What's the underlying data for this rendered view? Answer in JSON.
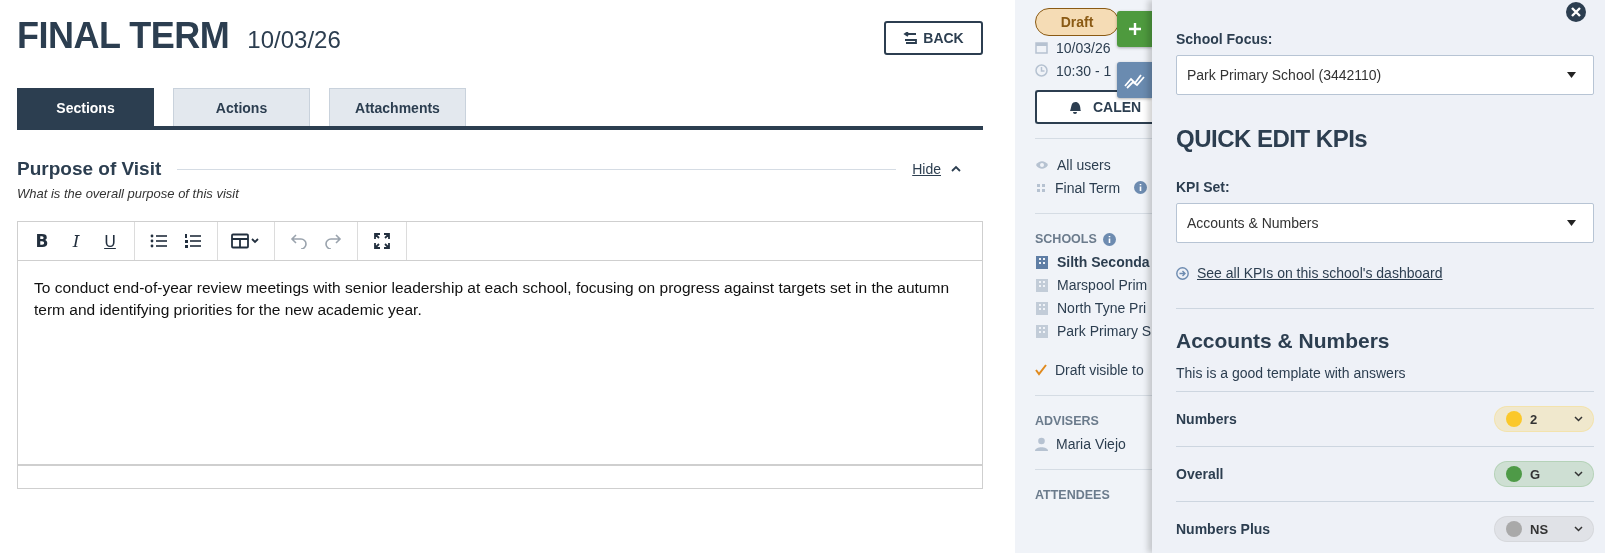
{
  "header": {
    "title": "FINAL TERM",
    "date": "10/03/26",
    "back_button": "BACK"
  },
  "tabs": [
    {
      "label": "Sections",
      "selected": true
    },
    {
      "label": "Actions",
      "selected": false
    },
    {
      "label": "Attachments",
      "selected": false
    }
  ],
  "section": {
    "title": "Purpose of Visit",
    "toggle": "Hide",
    "subtitle": "What is the overall purpose of this visit",
    "toolbar": [
      [
        {
          "kind": "bold",
          "label": "B",
          "disabled": false
        },
        {
          "kind": "italic",
          "label": "I",
          "disabled": false
        },
        {
          "kind": "underline",
          "label": "U",
          "disabled": false
        }
      ],
      [
        {
          "kind": "bullet-list",
          "disabled": false
        },
        {
          "kind": "numbered-list",
          "disabled": false
        }
      ],
      [
        {
          "kind": "table",
          "disabled": false
        }
      ],
      [
        {
          "kind": "undo",
          "disabled": true
        },
        {
          "kind": "redo",
          "disabled": true
        }
      ],
      [
        {
          "kind": "fullscreen",
          "disabled": false
        }
      ]
    ],
    "content": "To conduct end-of-year review meetings with senior leadership at each school, focusing on progress against targets set in the autumn term and identifying priorities for the new academic year."
  },
  "sidebar": {
    "status": "Draft",
    "date": "10/03/26",
    "time": "10:30 - 1",
    "calendar_button": "CALEN",
    "visibility": "All users",
    "template": "Final Term",
    "schools_label": "SCHOOLS",
    "schools": [
      {
        "name": "Silth Seconda",
        "selected": true
      },
      {
        "name": "Marspool Prim",
        "selected": false
      },
      {
        "name": "North Tyne Pri",
        "selected": false
      },
      {
        "name": "Park Primary S",
        "selected": false
      }
    ],
    "draft_note": "Draft visible to",
    "advisers_label": "ADVISERS",
    "advisers": [
      "Maria Viejo"
    ],
    "attendees_label": "ATTENDEES"
  },
  "panel": {
    "school_focus_label": "School Focus:",
    "school_focus": "Park Primary School (3442110)",
    "heading": "QUICK EDIT KPIs",
    "kpi_set_label": "KPI Set:",
    "kpi_set": "Accounts & Numbers",
    "dashboard_link": "See all KPIs on this school's dashboard",
    "set_title": "Accounts & Numbers",
    "set_description": "This is a good template with answers",
    "kpis": [
      {
        "name": "Numbers",
        "value": "2",
        "color": "#fbc82a"
      },
      {
        "name": "Overall",
        "value": "G",
        "color": "#4e9a47"
      },
      {
        "name": "Numbers Plus",
        "value": "NS",
        "color": "#a9a9a9"
      }
    ]
  }
}
